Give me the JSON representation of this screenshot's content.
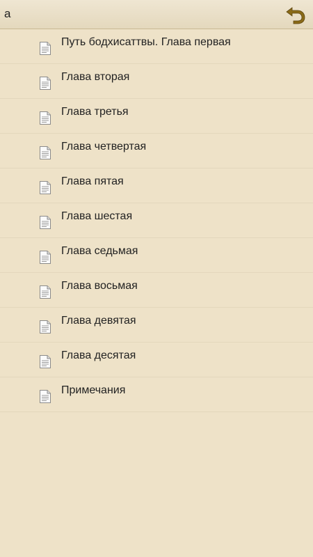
{
  "header": {
    "title": "а",
    "back_icon": "back-arrow-icon"
  },
  "list": {
    "icon": "document-icon",
    "items": [
      {
        "label": "Путь бодхисаттвы. Глава первая"
      },
      {
        "label": "Глава вторая"
      },
      {
        "label": "Глава третья"
      },
      {
        "label": "Глава четвертая"
      },
      {
        "label": "Глава пятая"
      },
      {
        "label": "Глава шестая"
      },
      {
        "label": "Глава седьмая"
      },
      {
        "label": "Глава восьмая"
      },
      {
        "label": "Глава девятая"
      },
      {
        "label": "Глава десятая"
      },
      {
        "label": "Примечания"
      }
    ]
  },
  "colors": {
    "background": "#eee2c8",
    "accent": "#8a6a17"
  }
}
